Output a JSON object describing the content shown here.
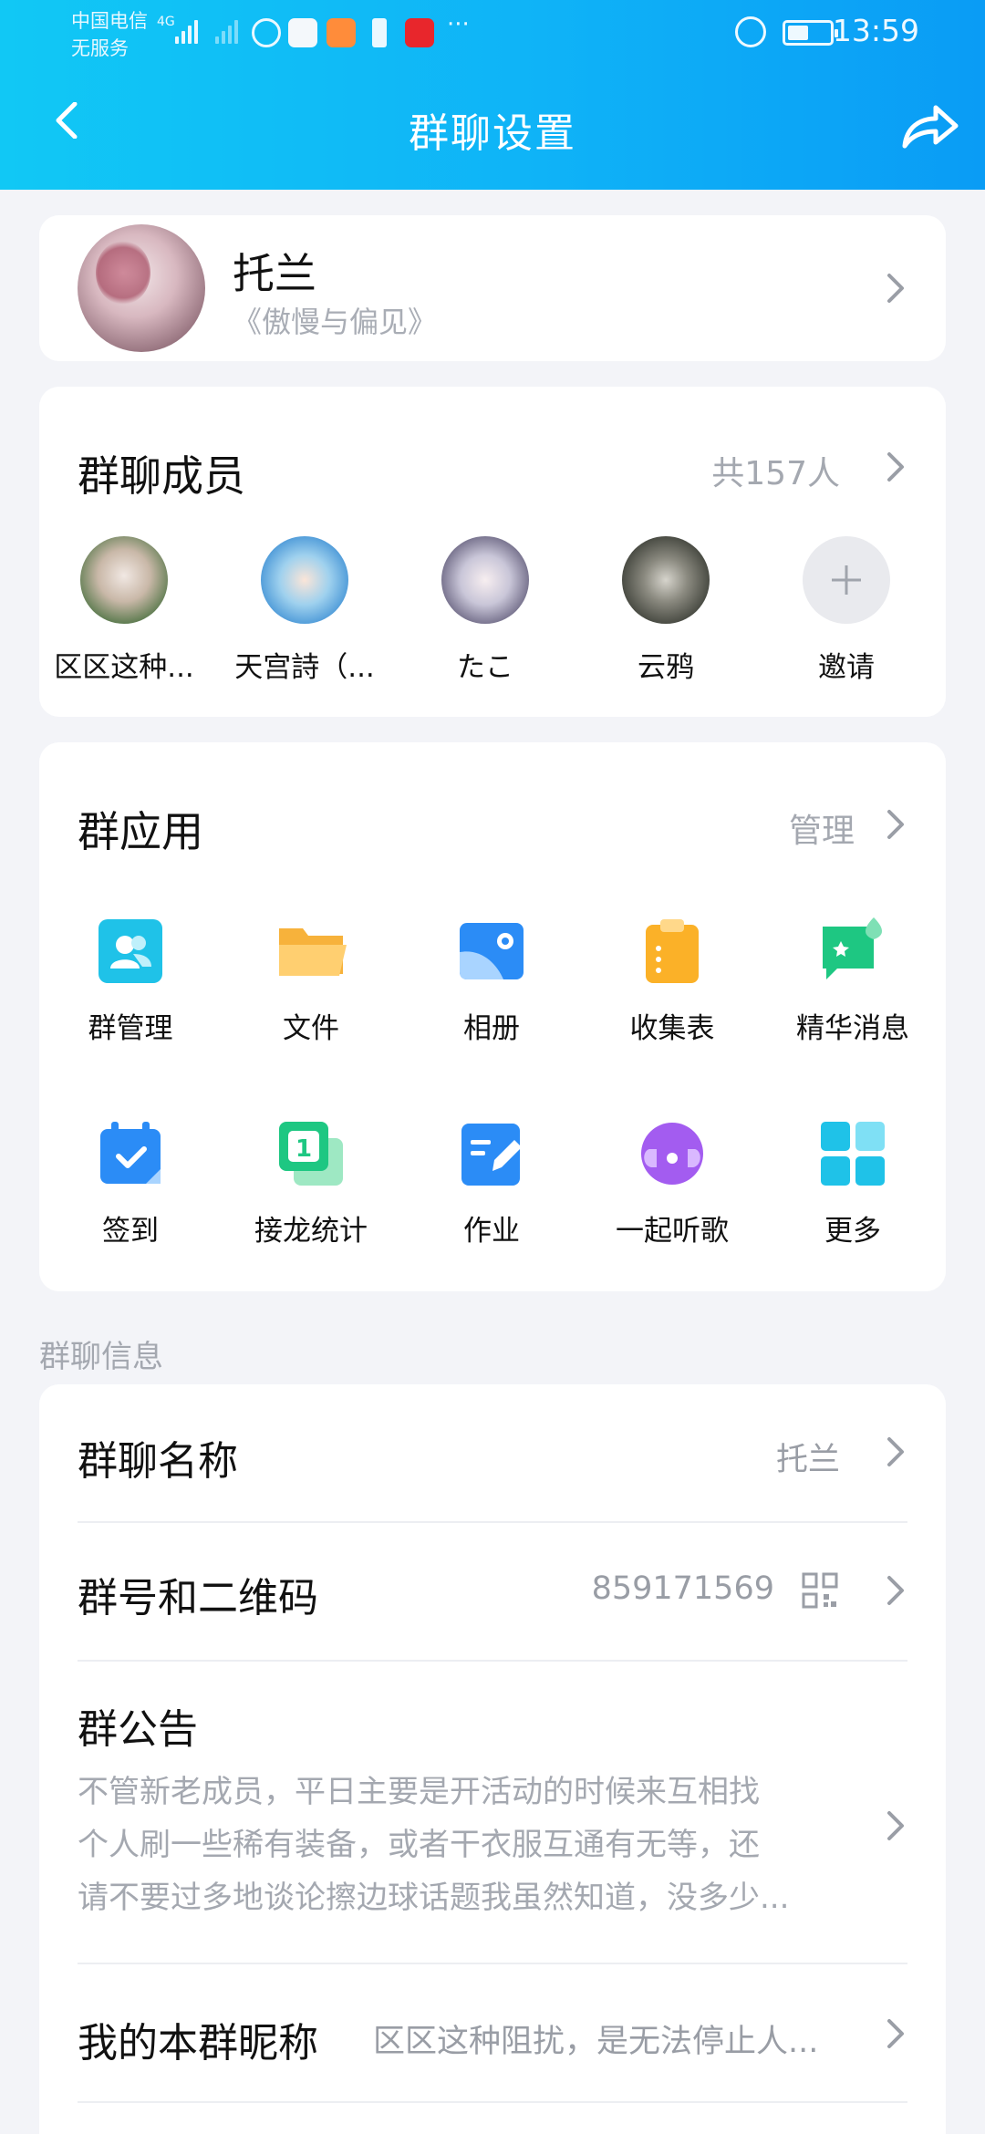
{
  "status_bar": {
    "carrier_line1": "中国电信",
    "carrier_line2": "无服务",
    "network": "4G",
    "more": "···",
    "time": "13:59"
  },
  "header": {
    "title": "群聊设置",
    "back_icon": "back-arrow-icon",
    "share_icon": "share-icon"
  },
  "profile": {
    "name": "托兰",
    "subtitle": "《傲慢与偏见》"
  },
  "members": {
    "title": "群聊成员",
    "count": "共157人",
    "items": [
      {
        "name": "区区这种..."
      },
      {
        "name": "天宫詩（..."
      },
      {
        "name": "たこ"
      },
      {
        "name": "云鸦"
      },
      {
        "name": "邀请"
      }
    ]
  },
  "apps": {
    "title": "群应用",
    "manage": "管理",
    "items": [
      {
        "label": "群管理",
        "icon": "group-manage-icon"
      },
      {
        "label": "文件",
        "icon": "folder-icon"
      },
      {
        "label": "相册",
        "icon": "album-icon"
      },
      {
        "label": "收集表",
        "icon": "clipboard-icon"
      },
      {
        "label": "精华消息",
        "icon": "highlight-message-icon"
      },
      {
        "label": "签到",
        "icon": "checkin-calendar-icon"
      },
      {
        "label": "接龙统计",
        "icon": "relay-stats-icon"
      },
      {
        "label": "作业",
        "icon": "homework-icon"
      },
      {
        "label": "一起听歌",
        "icon": "listen-together-icon"
      },
      {
        "label": "更多",
        "icon": "more-grid-icon"
      }
    ]
  },
  "info": {
    "section_label": "群聊信息",
    "name_title": "群聊名称",
    "name_value": "托兰",
    "number_title": "群号和二维码",
    "number_value": "859171569",
    "notice_title": "群公告",
    "notice_lines": [
      "不管新老成员，平日主要是开活动的时候来互相找",
      "个人刷一些稀有装备，或者干衣服互通有无等，还",
      "请不要过多地谈论擦边球话题我虽然知道，没多少..."
    ],
    "nickname_title": "我的本群昵称",
    "nickname_value": "区区这种阻扰，是无法停止人..."
  },
  "colors": {
    "header_start": "#11c8f5",
    "header_end": "#0a9cf5",
    "background": "#f3f4f8"
  }
}
